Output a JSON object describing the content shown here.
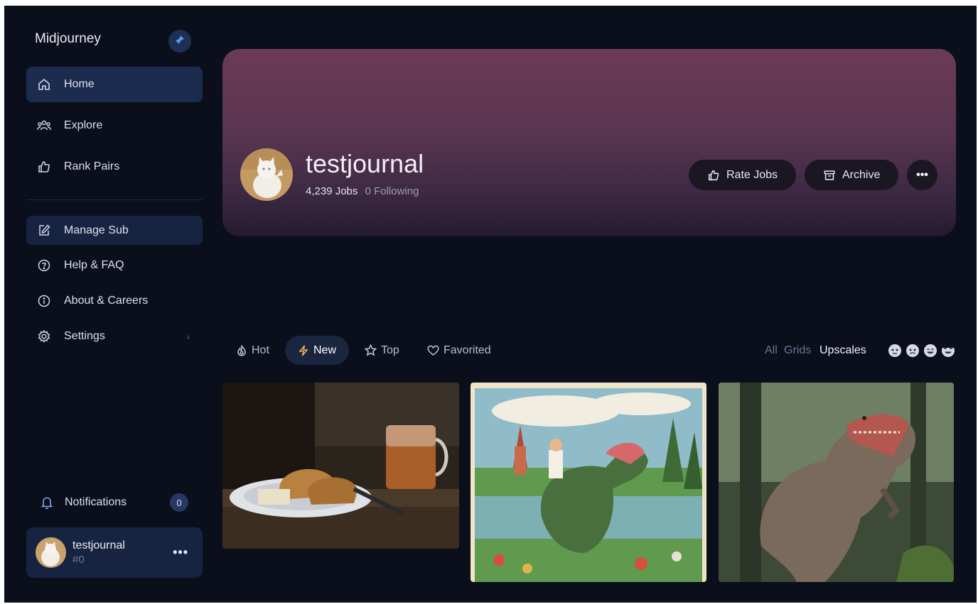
{
  "sidebar": {
    "brand": "Midjourney",
    "nav": [
      {
        "label": "Home",
        "icon": "home-icon"
      },
      {
        "label": "Explore",
        "icon": "people-icon"
      },
      {
        "label": "Rank Pairs",
        "icon": "thumbs-up-icon"
      }
    ],
    "secondary": [
      {
        "label": "Manage Sub",
        "icon": "edit-icon"
      },
      {
        "label": "Help & FAQ",
        "icon": "help-icon"
      },
      {
        "label": "About & Careers",
        "icon": "info-icon"
      },
      {
        "label": "Settings",
        "icon": "gear-icon"
      }
    ],
    "notifications": {
      "label": "Notifications",
      "count": "0"
    },
    "user": {
      "name": "testjournal",
      "tag": "#0"
    }
  },
  "profile": {
    "name": "testjournal",
    "jobs": "4,239 Jobs",
    "following": "0 Following",
    "rate_jobs": "Rate Jobs",
    "archive": "Archive",
    "more": "•••"
  },
  "tabs": [
    "Hot",
    "New",
    "Top",
    "Favorited"
  ],
  "active_tab": "New",
  "filters": {
    "all": "All",
    "grids": "Grids",
    "upscales": "Upscales"
  },
  "gallery": [
    {
      "subject": "bread and tea still life"
    },
    {
      "subject": "boy riding a dinosaur, vintage illustration"
    },
    {
      "subject": "roaring dinosaur in a forest"
    }
  ],
  "colors": {
    "background": "#0b0e1b",
    "active_nav": "#1c2c4f",
    "banner": "#5a3550",
    "accent_new": "#f2b84b"
  }
}
